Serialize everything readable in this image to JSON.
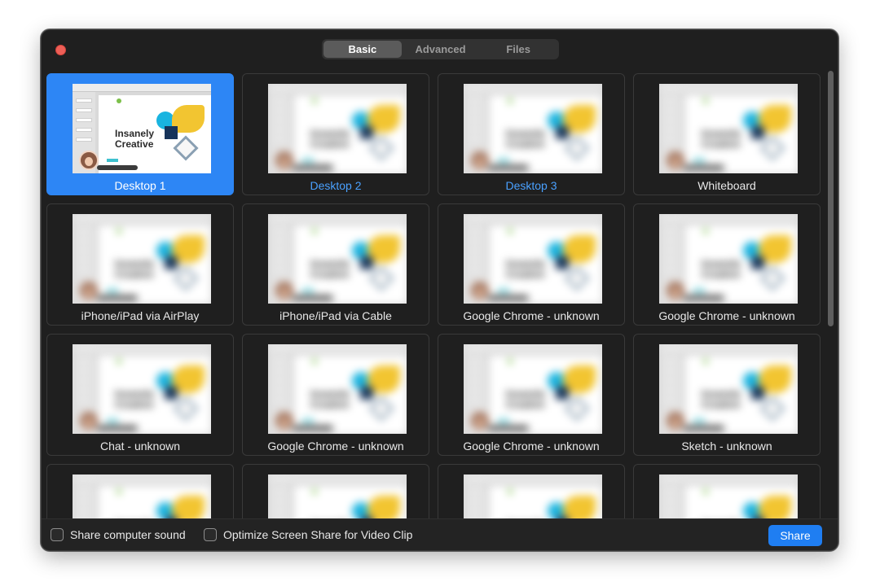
{
  "window": {
    "tabs": [
      {
        "label": "Basic",
        "active": true
      },
      {
        "label": "Advanced",
        "active": false
      },
      {
        "label": "Files",
        "active": false
      }
    ]
  },
  "thumbnail_preview": {
    "text_line1": "Insanely",
    "text_line2": "Creative"
  },
  "tiles": [
    {
      "label": "Desktop 1",
      "selected": true,
      "link": false
    },
    {
      "label": "Desktop 2",
      "selected": false,
      "link": true
    },
    {
      "label": "Desktop 3",
      "selected": false,
      "link": true
    },
    {
      "label": "Whiteboard",
      "selected": false,
      "link": false
    },
    {
      "label": "iPhone/iPad via AirPlay",
      "selected": false,
      "link": false
    },
    {
      "label": "iPhone/iPad via Cable",
      "selected": false,
      "link": false
    },
    {
      "label": "Google Chrome - unknown",
      "selected": false,
      "link": false
    },
    {
      "label": "Google Chrome - unknown",
      "selected": false,
      "link": false
    },
    {
      "label": "Chat - unknown",
      "selected": false,
      "link": false
    },
    {
      "label": "Google Chrome - unknown",
      "selected": false,
      "link": false
    },
    {
      "label": "Google Chrome - unknown",
      "selected": false,
      "link": false
    },
    {
      "label": "Sketch - unknown",
      "selected": false,
      "link": false
    },
    {
      "label": "",
      "selected": false,
      "link": false
    },
    {
      "label": "",
      "selected": false,
      "link": false
    },
    {
      "label": "",
      "selected": false,
      "link": false
    },
    {
      "label": "",
      "selected": false,
      "link": false
    }
  ],
  "footer": {
    "share_sound_label": "Share computer sound",
    "share_sound_checked": false,
    "optimize_label": "Optimize Screen Share for Video Clip",
    "optimize_checked": false,
    "share_button_label": "Share"
  },
  "colors": {
    "accent": "#2d86f5",
    "link": "#4aa1ff",
    "close": "#ed5f57"
  }
}
